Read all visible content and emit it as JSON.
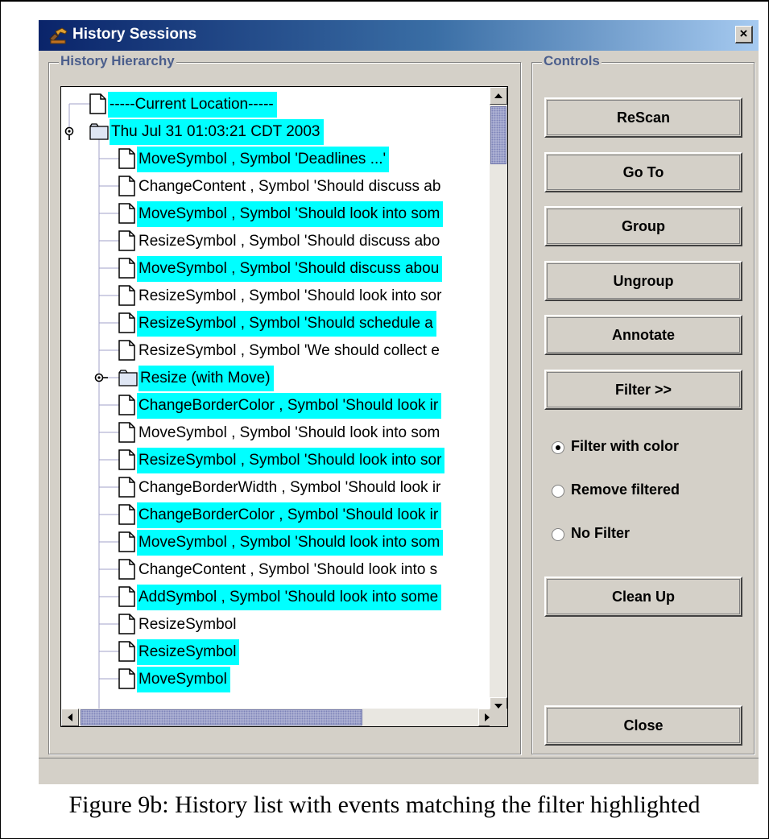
{
  "window": {
    "title": "History Sessions",
    "close_glyph": "×",
    "app_icon": "hammer-icon"
  },
  "history": {
    "legend": "History Hierarchy",
    "highlight_color": "#00ffff",
    "nodes": [
      {
        "label": "-----Current Location-----",
        "depth": 0,
        "icon": "document-icon",
        "highlighted": true
      },
      {
        "label": "Thu Jul 31 01:03:21 CDT 2003",
        "depth": 0,
        "icon": "folder-icon",
        "expanded": true,
        "highlighted": true
      },
      {
        "label": "MoveSymbol , Symbol 'Deadlines ...'",
        "depth": 1,
        "icon": "document-icon",
        "highlighted": true
      },
      {
        "label": "ChangeContent , Symbol 'Should discuss ab",
        "depth": 1,
        "icon": "document-icon",
        "highlighted": false
      },
      {
        "label": "MoveSymbol , Symbol 'Should look into som",
        "depth": 1,
        "icon": "document-icon",
        "highlighted": true
      },
      {
        "label": "ResizeSymbol , Symbol 'Should discuss abo",
        "depth": 1,
        "icon": "document-icon",
        "highlighted": false
      },
      {
        "label": "MoveSymbol , Symbol 'Should discuss abou",
        "depth": 1,
        "icon": "document-icon",
        "highlighted": true
      },
      {
        "label": "ResizeSymbol , Symbol 'Should look into sor",
        "depth": 1,
        "icon": "document-icon",
        "highlighted": false
      },
      {
        "label": "ResizeSymbol , Symbol 'Should schedule a",
        "depth": 1,
        "icon": "document-icon",
        "highlighted": true
      },
      {
        "label": "ResizeSymbol , Symbol 'We should collect e",
        "depth": 1,
        "icon": "document-icon",
        "highlighted": false
      },
      {
        "label": "Resize (with Move)",
        "depth": 1,
        "icon": "folder-icon",
        "expanded": false,
        "highlighted": true
      },
      {
        "label": "ChangeBorderColor , Symbol 'Should look ir",
        "depth": 1,
        "icon": "document-icon",
        "highlighted": true
      },
      {
        "label": "MoveSymbol , Symbol 'Should look into som",
        "depth": 1,
        "icon": "document-icon",
        "highlighted": false
      },
      {
        "label": "ResizeSymbol , Symbol 'Should look into sor",
        "depth": 1,
        "icon": "document-icon",
        "highlighted": true
      },
      {
        "label": "ChangeBorderWidth , Symbol 'Should look ir",
        "depth": 1,
        "icon": "document-icon",
        "highlighted": false
      },
      {
        "label": "ChangeBorderColor , Symbol 'Should look ir",
        "depth": 1,
        "icon": "document-icon",
        "highlighted": true
      },
      {
        "label": "MoveSymbol , Symbol 'Should look into som",
        "depth": 1,
        "icon": "document-icon",
        "highlighted": true
      },
      {
        "label": "ChangeContent , Symbol 'Should look into s",
        "depth": 1,
        "icon": "document-icon",
        "highlighted": false
      },
      {
        "label": "AddSymbol , Symbol 'Should look into some",
        "depth": 1,
        "icon": "document-icon",
        "highlighted": true
      },
      {
        "label": "ResizeSymbol",
        "depth": 1,
        "icon": "document-icon",
        "highlighted": false
      },
      {
        "label": "ResizeSymbol",
        "depth": 1,
        "icon": "document-icon",
        "highlighted": true
      },
      {
        "label": "MoveSymbol",
        "depth": 1,
        "icon": "document-icon",
        "highlighted": true
      }
    ]
  },
  "controls": {
    "legend": "Controls",
    "buttons": {
      "rescan": "ReScan",
      "goto": "Go To",
      "group": "Group",
      "ungroup": "Ungroup",
      "annotate": "Annotate",
      "filter": "Filter >>",
      "cleanup": "Clean Up",
      "close": "Close"
    },
    "filter_options": [
      {
        "label": "Filter with color",
        "selected": true
      },
      {
        "label": "Remove filtered",
        "selected": false
      },
      {
        "label": "No Filter",
        "selected": false
      }
    ]
  },
  "caption": "Figure 9b: History list with events matching the filter highlighted"
}
